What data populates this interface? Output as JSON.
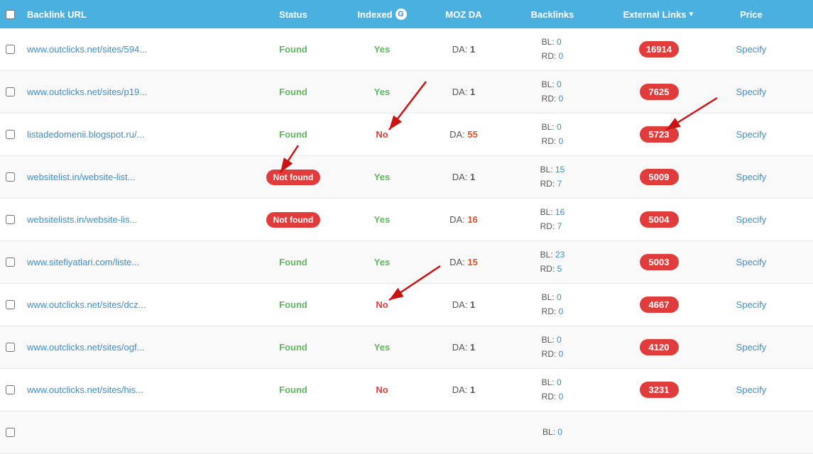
{
  "header": {
    "col_url": "Backlink URL",
    "col_status": "Status",
    "col_indexed": "Indexed",
    "col_moz": "MOZ DA",
    "col_backlinks": "Backlinks",
    "col_external": "External Links",
    "col_price": "Price"
  },
  "rows": [
    {
      "url": "www.outclicks.net/sites/594...",
      "status": "Found",
      "status_type": "found",
      "indexed": "Yes",
      "indexed_type": "yes",
      "da": "1",
      "bl": "0",
      "rd": "0",
      "external": "16914",
      "price": "Specify"
    },
    {
      "url": "www.outclicks.net/sites/p19...",
      "status": "Found",
      "status_type": "found",
      "indexed": "Yes",
      "indexed_type": "yes",
      "da": "1",
      "bl": "0",
      "rd": "0",
      "external": "7625",
      "price": "Specify"
    },
    {
      "url": "listadedomenii.blogspot.ru/...",
      "status": "Found",
      "status_type": "found",
      "indexed": "No",
      "indexed_type": "no",
      "da": "55",
      "bl": "0",
      "rd": "0",
      "external": "5723",
      "price": "Specify"
    },
    {
      "url": "websitelist.in/website-list...",
      "status": "Not found",
      "status_type": "notfound",
      "indexed": "Yes",
      "indexed_type": "yes",
      "da": "1",
      "bl": "15",
      "rd": "7",
      "external": "5009",
      "price": "Specify"
    },
    {
      "url": "websitelists.in/website-lis...",
      "status": "Not found",
      "status_type": "notfound",
      "indexed": "Yes",
      "indexed_type": "yes",
      "da": "16",
      "bl": "16",
      "rd": "7",
      "external": "5004",
      "price": "Specify"
    },
    {
      "url": "www.sitefiyatlari.com/liste...",
      "status": "Found",
      "status_type": "found",
      "indexed": "Yes",
      "indexed_type": "yes",
      "da": "15",
      "bl": "23",
      "rd": "5",
      "external": "5003",
      "price": "Specify"
    },
    {
      "url": "www.outclicks.net/sites/dcz...",
      "status": "Found",
      "status_type": "found",
      "indexed": "No",
      "indexed_type": "no",
      "da": "1",
      "bl": "0",
      "rd": "0",
      "external": "4667",
      "price": "Specify"
    },
    {
      "url": "www.outclicks.net/sites/ogf...",
      "status": "Found",
      "status_type": "found",
      "indexed": "Yes",
      "indexed_type": "yes",
      "da": "1",
      "bl": "0",
      "rd": "0",
      "external": "4120",
      "price": "Specify"
    },
    {
      "url": "www.outclicks.net/sites/his...",
      "status": "Found",
      "status_type": "found",
      "indexed": "No",
      "indexed_type": "no",
      "da": "1",
      "bl": "0",
      "rd": "0",
      "external": "3231",
      "price": "Specify"
    },
    {
      "url": "",
      "status": "",
      "status_type": "",
      "indexed": "",
      "indexed_type": "",
      "da": "",
      "bl": "0",
      "rd": "",
      "external": "",
      "price": ""
    }
  ]
}
